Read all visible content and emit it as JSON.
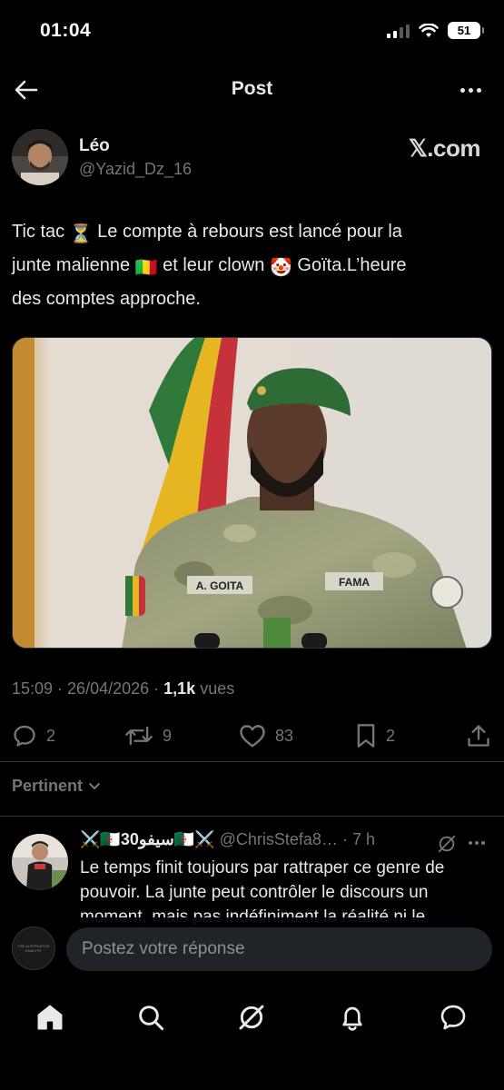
{
  "status": {
    "time": "01:04",
    "battery": "51"
  },
  "header": {
    "title": "Post"
  },
  "author": {
    "name": "Léo",
    "handle": "@Yazid_Dz_16",
    "watermark": "𝕏.com"
  },
  "tweet": {
    "line1_a": "Tic tac ",
    "line1_b": " Le compte à rebours est lancé pour la",
    "line2_a": "junte malienne ",
    "line2_b": " et leur clown ",
    "line2_c": " Goïta.L’heure",
    "line3": "des comptes approche.",
    "emoji_hourglass": "⏳",
    "emoji_flag": "🇲🇱",
    "emoji_clown": "🤡"
  },
  "image": {
    "name_tag": "A. GOITA",
    "unit_tag": "FAMA"
  },
  "meta": {
    "time": "15:09",
    "sep1": " · ",
    "date": "26/04/2026",
    "sep2": " · ",
    "views_count": "1,1k",
    "views_label": " vues"
  },
  "actions": {
    "replies": "2",
    "reposts": "9",
    "likes": "83",
    "bookmarks": "2"
  },
  "sort": {
    "label": "Pertinent"
  },
  "reply": {
    "name": "⚔️🇩🇿سيفو30🇩🇿⚔️",
    "handle": "@ChrisStefa8…",
    "time": " · 7 h",
    "text": "Le temps finit toujours par rattraper ce genre de pouvoir. La junte peut contrôler le discours un moment, mais pas indéfiniment la réalité ni le"
  },
  "compose": {
    "placeholder": "Postez votre réponse",
    "avatar_text": "THE ALTERNATIVE ANALYST"
  },
  "icons": {
    "back": "arrow-left-icon",
    "more": "more-icon",
    "reply": "reply-icon",
    "repost": "repost-icon",
    "like": "heart-icon",
    "bookmark": "bookmark-icon",
    "share": "share-icon",
    "home": "home-icon",
    "search": "search-icon",
    "grok": "grok-icon",
    "notifications": "bell-icon",
    "messages": "message-icon"
  },
  "colors": {
    "background": "#000000",
    "text": "#e7e9ea",
    "muted": "#71767b",
    "divider": "#2f3336"
  }
}
